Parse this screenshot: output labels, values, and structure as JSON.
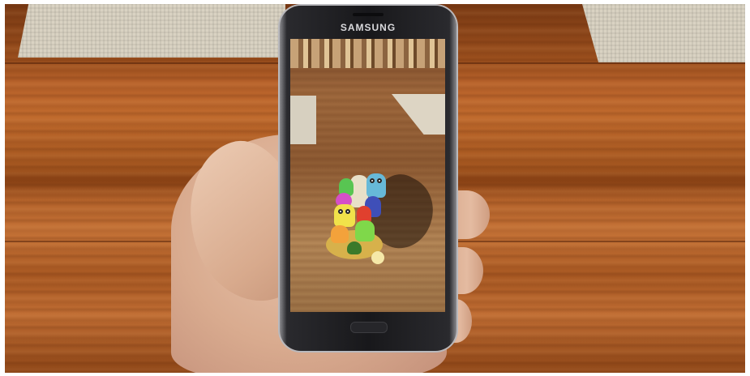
{
  "image": {
    "description_color": {
      "table_wood": "#b9632b",
      "phone_body": "#18181b",
      "skin": "#d9ab8f",
      "placemat": "#d9d2c2"
    }
  },
  "phone": {
    "brand": "SAMSUNG"
  }
}
